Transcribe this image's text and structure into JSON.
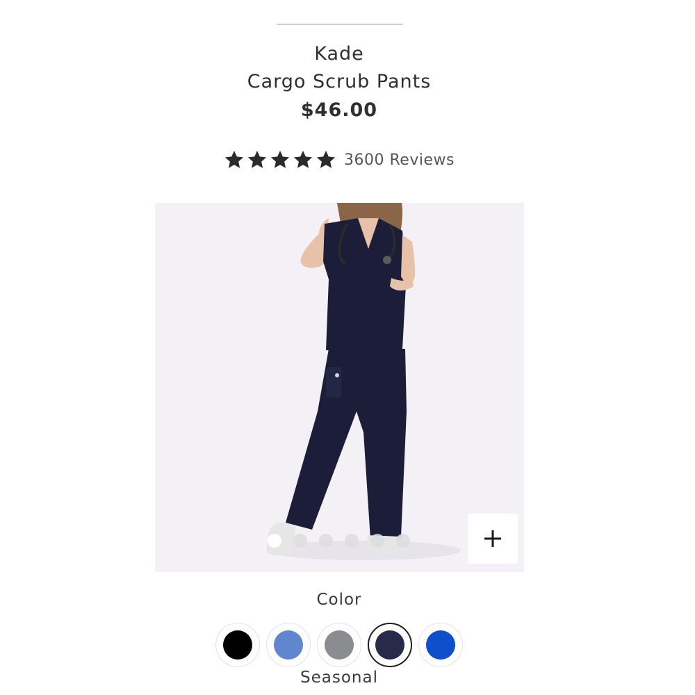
{
  "product": {
    "brand": "Kade",
    "name": "Cargo Scrub Pants",
    "price": "$46.00"
  },
  "rating": {
    "stars": 5,
    "star_icon": "star-icon",
    "star_color": "#2b2b2b",
    "reviews_label": "3600 Reviews"
  },
  "gallery": {
    "zoom_icon": "plus-icon",
    "image_count": 6,
    "active_index": 0,
    "background": "#f3f1f5",
    "garment_color": "#1c1d38"
  },
  "colors": {
    "label": "Color",
    "group_label": "Seasonal",
    "swatches": [
      {
        "color": "#000000",
        "selected": false
      },
      {
        "color": "#5f86cf",
        "selected": false
      },
      {
        "color": "#8a8c90",
        "selected": false
      },
      {
        "color": "#272a4a",
        "selected": true
      },
      {
        "color": "#0e4fcd",
        "selected": false
      }
    ]
  }
}
